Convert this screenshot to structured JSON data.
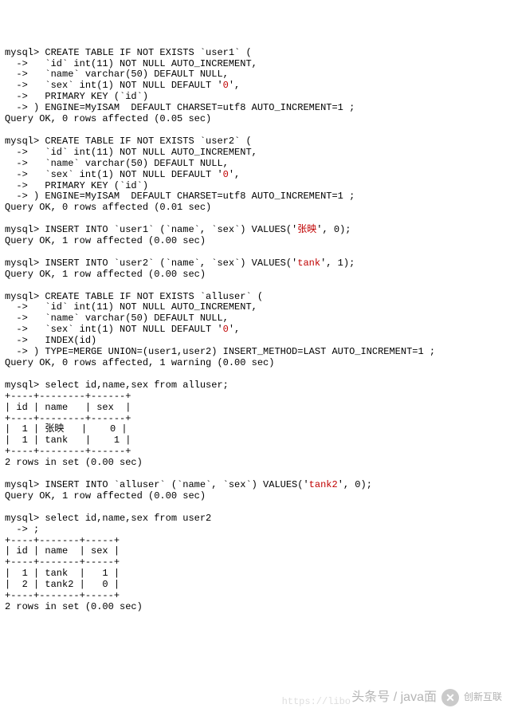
{
  "blocks": {
    "create_user1": {
      "l1": "mysql> CREATE TABLE IF NOT EXISTS `user1` (",
      "l2": "  ->   `id` int(11) NOT NULL AUTO_INCREMENT,",
      "l3": "  ->   `name` varchar(50) DEFAULT NULL,",
      "l4a": "  ->   `sex` int(1) NOT NULL DEFAULT '",
      "l4val": "0",
      "l4b": "',",
      "l5": "  ->   PRIMARY KEY (`id`)",
      "l6": "  -> ) ENGINE=MyISAM  DEFAULT CHARSET=utf8 AUTO_INCREMENT=1 ;",
      "result": "Query OK, 0 rows affected (0.05 sec)"
    },
    "create_user2": {
      "l1": "mysql> CREATE TABLE IF NOT EXISTS `user2` (",
      "l2": "  ->   `id` int(11) NOT NULL AUTO_INCREMENT,",
      "l3": "  ->   `name` varchar(50) DEFAULT NULL,",
      "l4a": "  ->   `sex` int(1) NOT NULL DEFAULT '",
      "l4val": "0",
      "l4b": "',",
      "l5": "  ->   PRIMARY KEY (`id`)",
      "l6": "  -> ) ENGINE=MyISAM  DEFAULT CHARSET=utf8 AUTO_INCREMENT=1 ;",
      "result": "Query OK, 0 rows affected (0.01 sec)"
    },
    "insert_u1": {
      "pre": "mysql> INSERT INTO `user1` (`name`, `sex`) VALUES('",
      "val": "张映",
      "post": "', 0);",
      "result": "Query OK, 1 row affected (0.00 sec)"
    },
    "insert_u2": {
      "pre": "mysql> INSERT INTO `user2` (`name`, `sex`) VALUES('",
      "val": "tank",
      "post": "', 1);",
      "result": "Query OK, 1 row affected (0.00 sec)"
    },
    "create_all": {
      "l1": "mysql> CREATE TABLE IF NOT EXISTS `alluser` (",
      "l2": "  ->   `id` int(11) NOT NULL AUTO_INCREMENT,",
      "l3": "  ->   `name` varchar(50) DEFAULT NULL,",
      "l4a": "  ->   `sex` int(1) NOT NULL DEFAULT '",
      "l4val": "0",
      "l4b": "',",
      "l5": "  ->   INDEX(id)",
      "l6": "  -> ) TYPE=MERGE UNION=(user1,user2) INSERT_METHOD=LAST AUTO_INCREMENT=1 ;",
      "result": "Query OK, 0 rows affected, 1 warning (0.00 sec)"
    },
    "select_all": {
      "stmt": "mysql> select id,name,sex from alluser;",
      "sep": "+----+--------+------+",
      "hdr": "| id | name   | sex  |",
      "r1": "|  1 | 张映   |    0 |",
      "r2": "|  1 | tank   |    1 |",
      "foot": "2 rows in set (0.00 sec)"
    },
    "insert_all": {
      "pre": "mysql> INSERT INTO `alluser` (`name`, `sex`) VALUES('",
      "val": "tank2",
      "post": "', 0);",
      "result": "Query OK, 1 row affected (0.00 sec)"
    },
    "select_u2": {
      "stmt": "mysql> select id,name,sex from user2",
      "cont": "  -> ;",
      "sep": "+----+-------+-----+",
      "hdr": "| id | name  | sex |",
      "r1": "|  1 | tank  |   1 |",
      "r2": "|  2 | tank2 |   0 |",
      "foot": "2 rows in set (0.00 sec)"
    }
  },
  "watermark": {
    "text": "头条号 / java面",
    "brand": "创新互联",
    "url": "https://libo"
  }
}
